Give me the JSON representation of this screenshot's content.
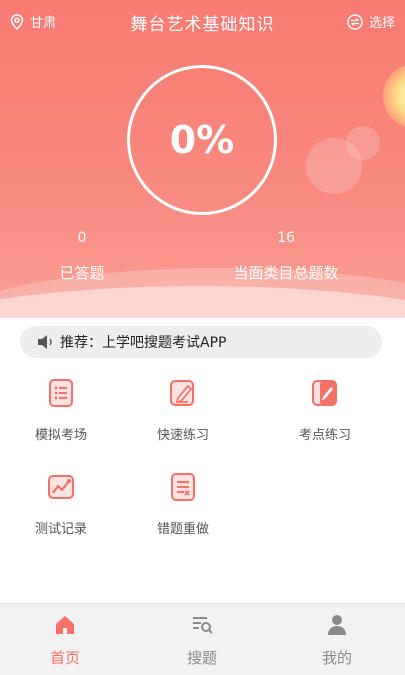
{
  "header": {
    "location": "甘肃",
    "title": "舞台艺术基础知识",
    "choose_label": "选择",
    "icons": {
      "location": "location-pin-icon",
      "choose": "switch-icon"
    }
  },
  "progress": {
    "percent_label": "0%",
    "percent": 0
  },
  "stats": [
    {
      "value": "0",
      "label": "已答题"
    },
    {
      "value": "16",
      "label": "当面类目总题数"
    }
  ],
  "notice": {
    "text": "推荐：上学吧搜题考试APP",
    "icon": "speaker-icon"
  },
  "features": [
    {
      "label": "模拟考场",
      "icon": "list-icon"
    },
    {
      "label": "快速练习",
      "icon": "edit-icon"
    },
    {
      "label": "考点练习",
      "icon": "notebook-pen-icon"
    },
    {
      "label": "测试记录",
      "icon": "chart-icon"
    },
    {
      "label": "错题重做",
      "icon": "document-icon"
    }
  ],
  "tabs": [
    {
      "label": "首页",
      "icon": "home-icon",
      "active": true
    },
    {
      "label": "搜题",
      "icon": "search-list-icon",
      "active": false
    },
    {
      "label": "我的",
      "icon": "user-icon",
      "active": false
    }
  ],
  "colors": {
    "primary": "#f77a72",
    "accent": "#f57168",
    "tab_inactive": "#8a8a8a"
  }
}
